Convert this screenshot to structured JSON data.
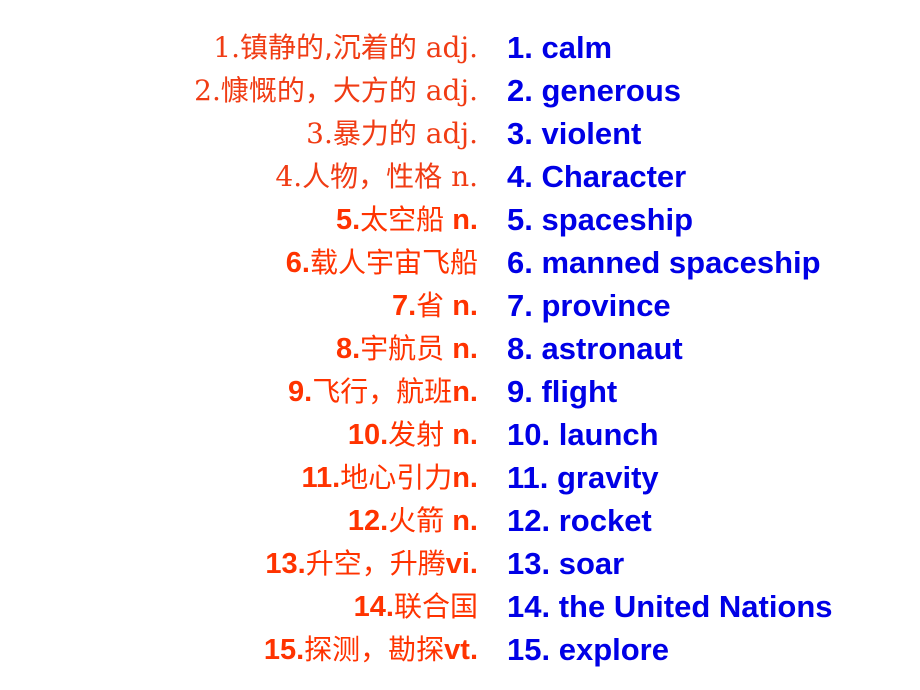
{
  "colors": {
    "chinese_text": "#ff3300",
    "english_text": "#0000e6",
    "background": "#ffffff"
  },
  "vocabulary": [
    {
      "num": "1.",
      "zh": "镇静的,沉着的",
      "pos": "adj.",
      "en": "1. calm"
    },
    {
      "num": "2.",
      "zh": "慷慨的，大方的",
      "pos": "adj.",
      "en": "2. generous"
    },
    {
      "num": "3.",
      "zh": "暴力的",
      "pos": "adj.",
      "en": "3. violent"
    },
    {
      "num": "4.",
      "zh": "人物，性格",
      "pos": "n.",
      "en": "4. Character"
    },
    {
      "num": "5.",
      "zh": "太空船",
      "pos": "n.",
      "en": "5. spaceship"
    },
    {
      "num": "6.",
      "zh": "载人宇宙飞船",
      "pos": "",
      "en": "6. manned spaceship"
    },
    {
      "num": "7.",
      "zh": "省",
      "pos": "n.",
      "en": "7. province"
    },
    {
      "num": "8.",
      "zh": "宇航员",
      "pos": "n.",
      "en": "8. astronaut"
    },
    {
      "num": "9.",
      "zh": "飞行，航班",
      "pos": "n.",
      "en": "9. flight"
    },
    {
      "num": "10.",
      "zh": "发射",
      "pos": "n.",
      "en": "10. launch"
    },
    {
      "num": "11.",
      "zh": "地心引力",
      "pos": "n.",
      "en": "11. gravity"
    },
    {
      "num": "12.",
      "zh": "火箭",
      "pos": "n.",
      "en": "12. rocket"
    },
    {
      "num": "13.",
      "zh": "升空，升腾",
      "pos": "vi.",
      "en": "13. soar"
    },
    {
      "num": "14.",
      "zh": "联合国",
      "pos": "",
      "en": "14. the United Nations"
    },
    {
      "num": "15.",
      "zh": "探测，勘探",
      "pos": "vt.",
      "en": "15. explore"
    }
  ]
}
